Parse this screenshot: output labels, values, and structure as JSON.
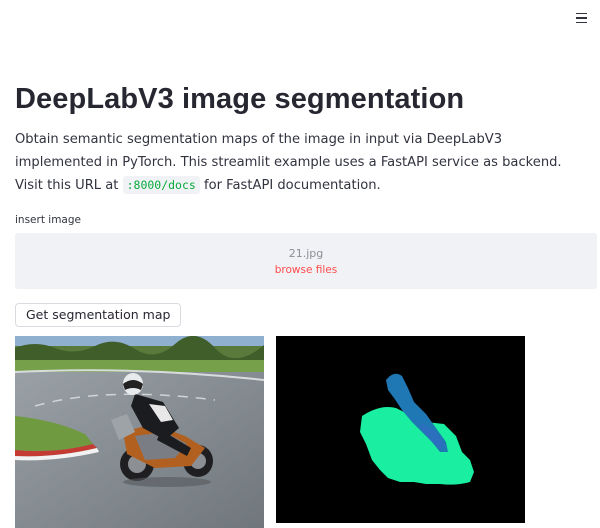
{
  "menu": {
    "icon": "hamburger-menu-icon"
  },
  "title": "DeepLabV3 image segmentation",
  "description": {
    "part1": "Obtain semantic segmentation maps of the image in input via DeepLabV3 implemented in PyTorch. This streamlit example uses a FastAPI service as backend. Visit this URL at",
    "code": ":8000/docs",
    "part2": "for FastAPI documentation."
  },
  "uploader": {
    "label": "insert image",
    "filename": "21.jpg",
    "browse_label": "browse files"
  },
  "button": {
    "label": "Get segmentation map"
  },
  "images": {
    "input_icon": "motorcycle-photo",
    "output_icon": "segmentation-map"
  },
  "colors": {
    "title": "#262730",
    "code_text": "#09ab3b",
    "browse_link": "#ff4b4b",
    "dropzone_bg": "#f0f2f6",
    "segment_person": "#1f77b4",
    "segment_motorbike": "#1aeea0"
  }
}
